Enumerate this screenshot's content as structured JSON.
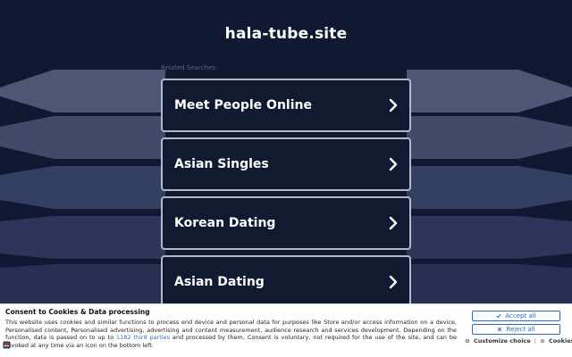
{
  "site": {
    "title": "hala-tube.site"
  },
  "related": {
    "label": "Related Searches:",
    "items": [
      {
        "label": "Meet People Online"
      },
      {
        "label": "Asian Singles"
      },
      {
        "label": "Korean Dating"
      },
      {
        "label": "Asian Dating"
      }
    ]
  },
  "consent": {
    "title": "Consent to Cookies & Data processing",
    "text_before_link": "This website uses cookies and similar functions to process end device and personal data for purposes like Store and/or access information on a device, Personalised content, Personalised advertising, advertising and content measurement, audience research and services development. Depending on the function, data is passed on to up to ",
    "link_text": "1182 third parties",
    "text_after_link": " and processed by them. Consent is voluntary, not required for the use of the site, and can be revoked at any time via an icon on the bottom left.",
    "accept_label": "Accept all",
    "reject_label": "Reject all",
    "customize_label": "Customize choice",
    "separator": "|",
    "cookies_label": "Cookies"
  },
  "colors": {
    "background": "#111831",
    "card_border": "#b5b8c6",
    "accent": "#2f6db5"
  },
  "icons": {
    "card_arrow": "chevron-right-icon",
    "accept": "check-icon",
    "reject": "close-icon",
    "customize": "gear-icon",
    "cookies": "cookie-icon"
  }
}
